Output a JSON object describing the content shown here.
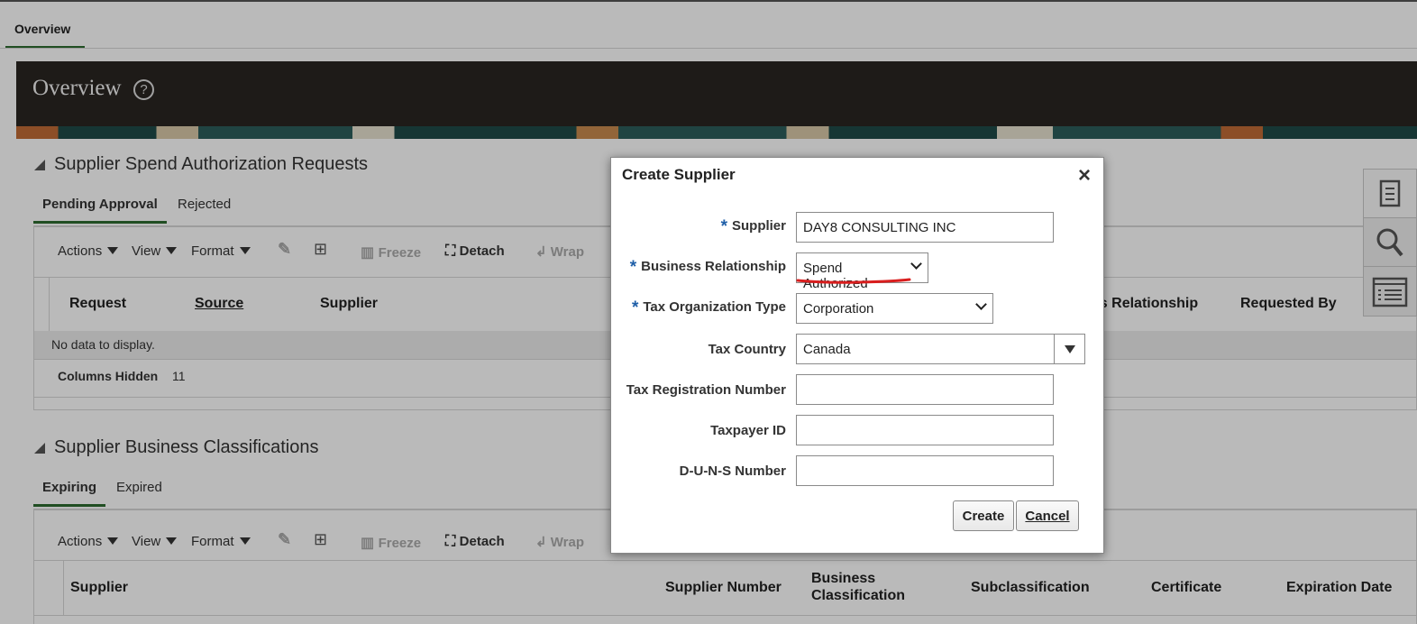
{
  "top_tab": "Overview",
  "banner": {
    "title": "Overview"
  },
  "section1": {
    "title": "Supplier Spend Authorization Requests",
    "tabs": [
      "Pending Approval",
      "Rejected"
    ],
    "toolbar": {
      "actions": "Actions",
      "view": "View",
      "format": "Format",
      "freeze": "Freeze",
      "detach": "Detach",
      "wrap": "Wrap"
    },
    "columns": [
      "Request",
      "Source",
      "Supplier",
      "Business Relationship",
      "Requested By"
    ],
    "partial_column": "ess Relationship",
    "no_data": "No data to display.",
    "columns_hidden_label": "Columns Hidden",
    "columns_hidden_count": "11"
  },
  "section2": {
    "title": "Supplier Business Classifications",
    "tabs": [
      "Expiring",
      "Expired"
    ],
    "toolbar": {
      "actions": "Actions",
      "view": "View",
      "format": "Format",
      "freeze": "Freeze",
      "detach": "Detach",
      "wrap": "Wrap"
    },
    "columns": [
      "Supplier",
      "Supplier Number",
      "Business Classification",
      "Subclassification",
      "Certificate",
      "Expiration Date"
    ]
  },
  "dialog": {
    "title": "Create Supplier",
    "fields": {
      "supplier": {
        "label": "Supplier",
        "value": "DAY8 CONSULTING INC",
        "required": true
      },
      "business_relationship": {
        "label": "Business Relationship",
        "value": "Spend Authorized",
        "required": true
      },
      "tax_org_type": {
        "label": "Tax Organization Type",
        "value": "Corporation",
        "required": true
      },
      "tax_country": {
        "label": "Tax Country",
        "value": "Canada"
      },
      "tax_registration_number": {
        "label": "Tax Registration Number",
        "value": ""
      },
      "taxpayer_id": {
        "label": "Taxpayer ID",
        "value": ""
      },
      "duns_number": {
        "label": "D-U-N-S Number",
        "value": ""
      }
    },
    "required_marker": "*",
    "buttons": {
      "create": "Create",
      "cancel": "Cancel"
    }
  },
  "icons": {
    "help": "?",
    "close": "×",
    "side_panel": [
      "document-icon",
      "search-icon",
      "list-icon"
    ]
  },
  "colors": {
    "accent_green": "#2e6b30",
    "required_blue": "#1f5fa8",
    "annotation_red": "#d91e1e"
  }
}
